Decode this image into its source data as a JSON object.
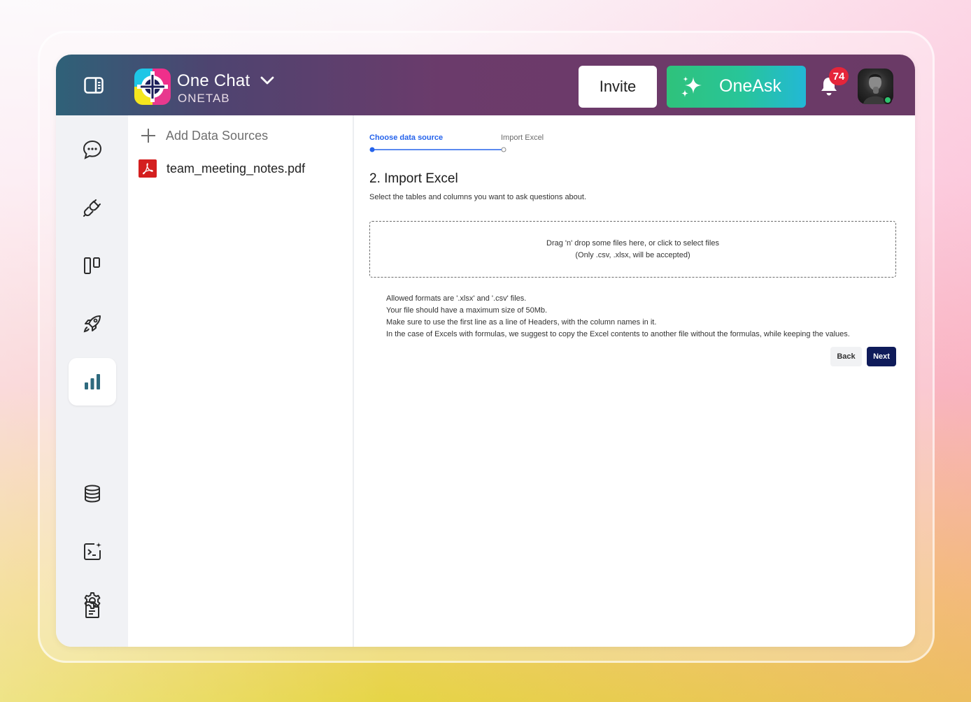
{
  "header": {
    "app_name": "One Chat",
    "workspace": "ONETAB",
    "invite_label": "Invite",
    "oneask_label": "OneAsk",
    "notification_count": "74"
  },
  "sidebar": {
    "items": [
      {
        "name": "chat",
        "icon": "chat-bubble-icon",
        "active": false
      },
      {
        "name": "integrations",
        "icon": "plug-icon",
        "active": false
      },
      {
        "name": "boards",
        "icon": "columns-icon",
        "active": false
      },
      {
        "name": "launch",
        "icon": "rocket-icon",
        "active": false
      },
      {
        "name": "analytics",
        "icon": "bar-chart-icon",
        "active": true
      },
      {
        "name": "database",
        "icon": "database-icon",
        "active": false
      },
      {
        "name": "ai-terminal",
        "icon": "terminal-sparkle-icon",
        "active": false
      },
      {
        "name": "documents",
        "icon": "document-icon",
        "active": false
      },
      {
        "name": "settings",
        "icon": "gear-icon",
        "active": false
      }
    ]
  },
  "panel": {
    "add_label": "Add Data Sources",
    "files": [
      {
        "name": "team_meeting_notes.pdf",
        "icon": "pdf-icon"
      }
    ]
  },
  "wizard": {
    "steps": [
      "Choose data source",
      "Import Excel"
    ],
    "title": "2. Import Excel",
    "description": "Select the tables and columns you want to ask questions about.",
    "dropzone_line1": "Drag 'n' drop some files here, or click to select files",
    "dropzone_line2": "(Only .csv, .xlsx, will be accepted)",
    "rules": [
      "Allowed formats are '.xlsx' and '.csv' files.",
      "Your file should have a maximum size of 50Mb.",
      "Make sure to use the first line as a line of Headers, with the column names in it.",
      "In the case of Excels with formulas, we suggest to copy the Excel contents to another file without the formulas, while keeping the values."
    ],
    "back_label": "Back",
    "next_label": "Next"
  },
  "colors": {
    "accent_blue": "#2563eb",
    "next_button": "#0f1b5a",
    "badge_red": "#e5253a",
    "oneask_green": "#2fc27b",
    "active_icon": "#2e6a7e"
  }
}
